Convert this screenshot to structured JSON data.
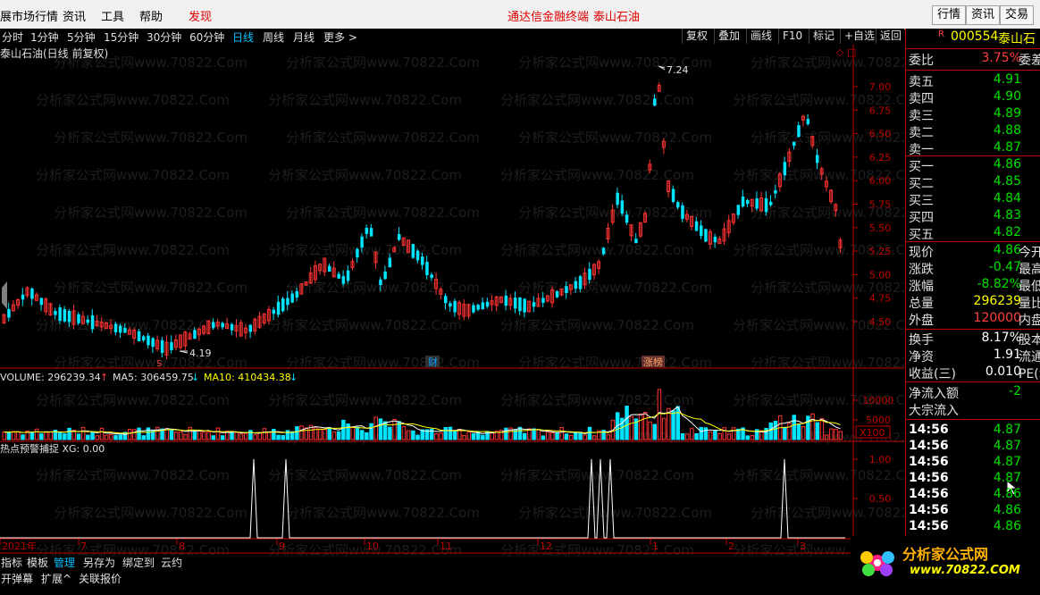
{
  "menubar": {
    "items": [
      "展市场行情",
      "资讯",
      "工具",
      "帮助"
    ],
    "discover": "发现",
    "center1": "通达信金融终端",
    "center2": "泰山石油",
    "buttons": [
      "行情",
      "资讯",
      "交易"
    ]
  },
  "periodbar": {
    "periods": [
      "分时",
      "1分钟",
      "5分钟",
      "15分钟",
      "30分钟",
      "60分钟",
      "日线",
      "周线",
      "月线",
      "更多 >"
    ],
    "selected_index": 6,
    "tools": [
      "复权",
      "叠加",
      "画线",
      "F10",
      "标记",
      "+自选",
      "返回"
    ]
  },
  "main_chart": {
    "title": "泰山石油(日线 前复权)",
    "high_label": "7.24",
    "low_label": "4.19",
    "badges": [
      "财",
      "涨榜"
    ],
    "y_ticks": [
      "7.00",
      "6.75",
      "6.50",
      "6.25",
      "6.00",
      "5.75",
      "5.50",
      "5.25",
      "5.00",
      "4.75",
      "4.50"
    ]
  },
  "volume_panel": {
    "vol_label": "VOLUME: 296239.34",
    "ma5_label": "MA5: 306459.75",
    "ma10_label": "MA10: 410434.38",
    "y_ticks": [
      "10000",
      "5000"
    ],
    "unit": "X100"
  },
  "indicator_panel": {
    "label": "热点预警捕捉 XG: 0.00",
    "y_ticks": [
      "1.00",
      "0.50"
    ]
  },
  "x_axis": {
    "labels": [
      "2021年",
      "7",
      "8",
      "9",
      "10",
      "11",
      "12",
      "1",
      "2",
      "3"
    ]
  },
  "right_panel": {
    "code": "000554",
    "name": "泰山石",
    "webi_label": "委比",
    "webi_value": "3.75%",
    "webi_extra": "委差",
    "sells": [
      {
        "label": "卖五",
        "price": "4.91"
      },
      {
        "label": "卖四",
        "price": "4.90"
      },
      {
        "label": "卖三",
        "price": "4.89"
      },
      {
        "label": "卖二",
        "price": "4.88"
      },
      {
        "label": "卖一",
        "price": "4.87"
      }
    ],
    "buys": [
      {
        "label": "买一",
        "price": "4.86"
      },
      {
        "label": "买二",
        "price": "4.85"
      },
      {
        "label": "买三",
        "price": "4.84"
      },
      {
        "label": "买四",
        "price": "4.83"
      },
      {
        "label": "买五",
        "price": "4.82"
      }
    ],
    "stats": [
      {
        "label": "现价",
        "value": "4.86",
        "extra": "今开"
      },
      {
        "label": "涨跌",
        "value": "-0.47",
        "extra": "最高"
      },
      {
        "label": "涨幅",
        "value": "-8.82%",
        "extra": "最低"
      },
      {
        "label": "总量",
        "value": "296239",
        "extra": "量比"
      },
      {
        "label": "外盘",
        "value": "120000",
        "extra": "内盘"
      }
    ],
    "stats2": [
      {
        "label": "换手",
        "value": "8.17%",
        "extra": "股本"
      },
      {
        "label": "净资",
        "value": "1.91",
        "extra": "流通"
      },
      {
        "label": "收益(三)",
        "value": "0.010",
        "extra": "PE(动"
      }
    ],
    "flow": [
      {
        "label": "净流入额",
        "value": "-2"
      },
      {
        "label": "大宗流入",
        "value": ""
      }
    ],
    "ticks": [
      {
        "time": "14:56",
        "price": "4.87"
      },
      {
        "time": "14:56",
        "price": "4.87"
      },
      {
        "time": "14:56",
        "price": "4.87"
      },
      {
        "time": "14:56",
        "price": "4.87"
      },
      {
        "time": "14:56",
        "price": "4.86"
      },
      {
        "time": "14:56",
        "price": "4.86"
      },
      {
        "time": "14:56",
        "price": "4.86"
      }
    ]
  },
  "bottombar": {
    "row1": [
      "指标",
      "模板",
      "管理",
      "另存为",
      "绑定到",
      "云约"
    ],
    "row2": [
      "开弹幕",
      "扩展^",
      "关联报价"
    ]
  },
  "watermark": "分析家公式网www.70822.Com",
  "logo": {
    "line1": "分析家公式网",
    "line2": "www.70822.COM"
  },
  "colors": {
    "up": "#ff3232",
    "down": "#00e4ff",
    "axis": "#c00000",
    "ma5": "#ffffff",
    "ma10": "#ffff00"
  }
}
